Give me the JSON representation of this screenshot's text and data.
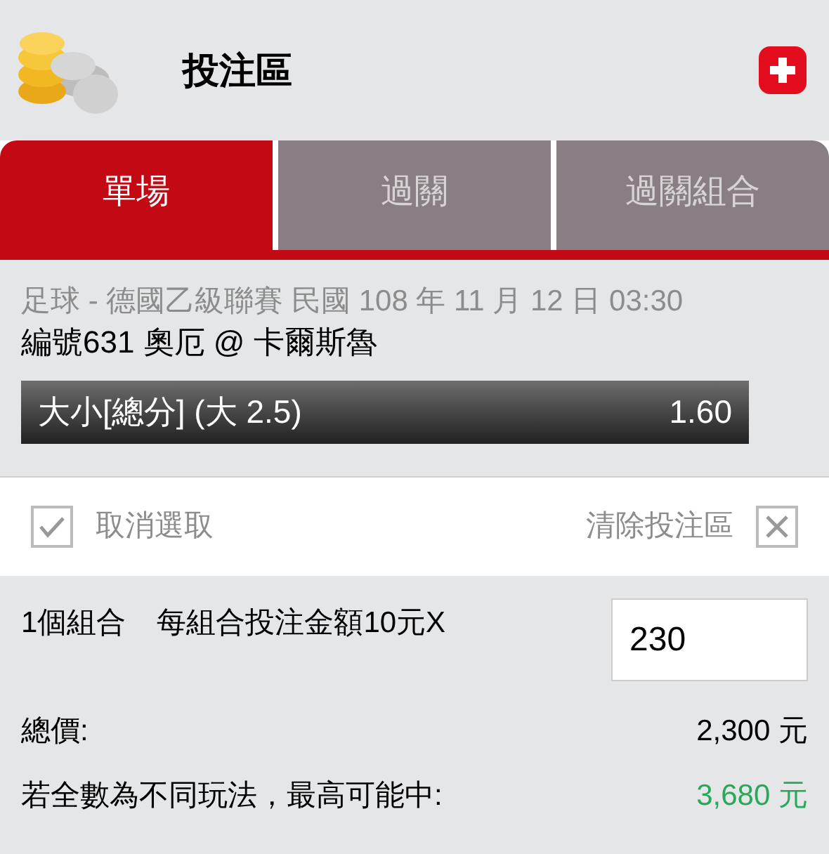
{
  "header": {
    "title": "投注區"
  },
  "tabs": [
    {
      "label": "單場",
      "selected": true
    },
    {
      "label": "過關",
      "selected": false
    },
    {
      "label": "過關組合",
      "selected": false
    }
  ],
  "match": {
    "info": "足球 - 德國乙級聯賽 民國 108 年 11 月 12 日 03:30",
    "teams": "編號631 奧厄 @ 卡爾斯魯",
    "selection": "大小[總分] (大 2.5)",
    "odds": "1.60"
  },
  "actions": {
    "deselect": "取消選取",
    "clear": "清除投注區"
  },
  "bet": {
    "combo": "1個組合",
    "unit": "每組合投注金額10元X",
    "amount": "230"
  },
  "totals": [
    {
      "label": "總價:",
      "value": "2,300 元",
      "kind": "plain"
    },
    {
      "label": "若全數為不同玩法，最高可能中:",
      "value": "3,680 元",
      "kind": "highlight"
    }
  ]
}
